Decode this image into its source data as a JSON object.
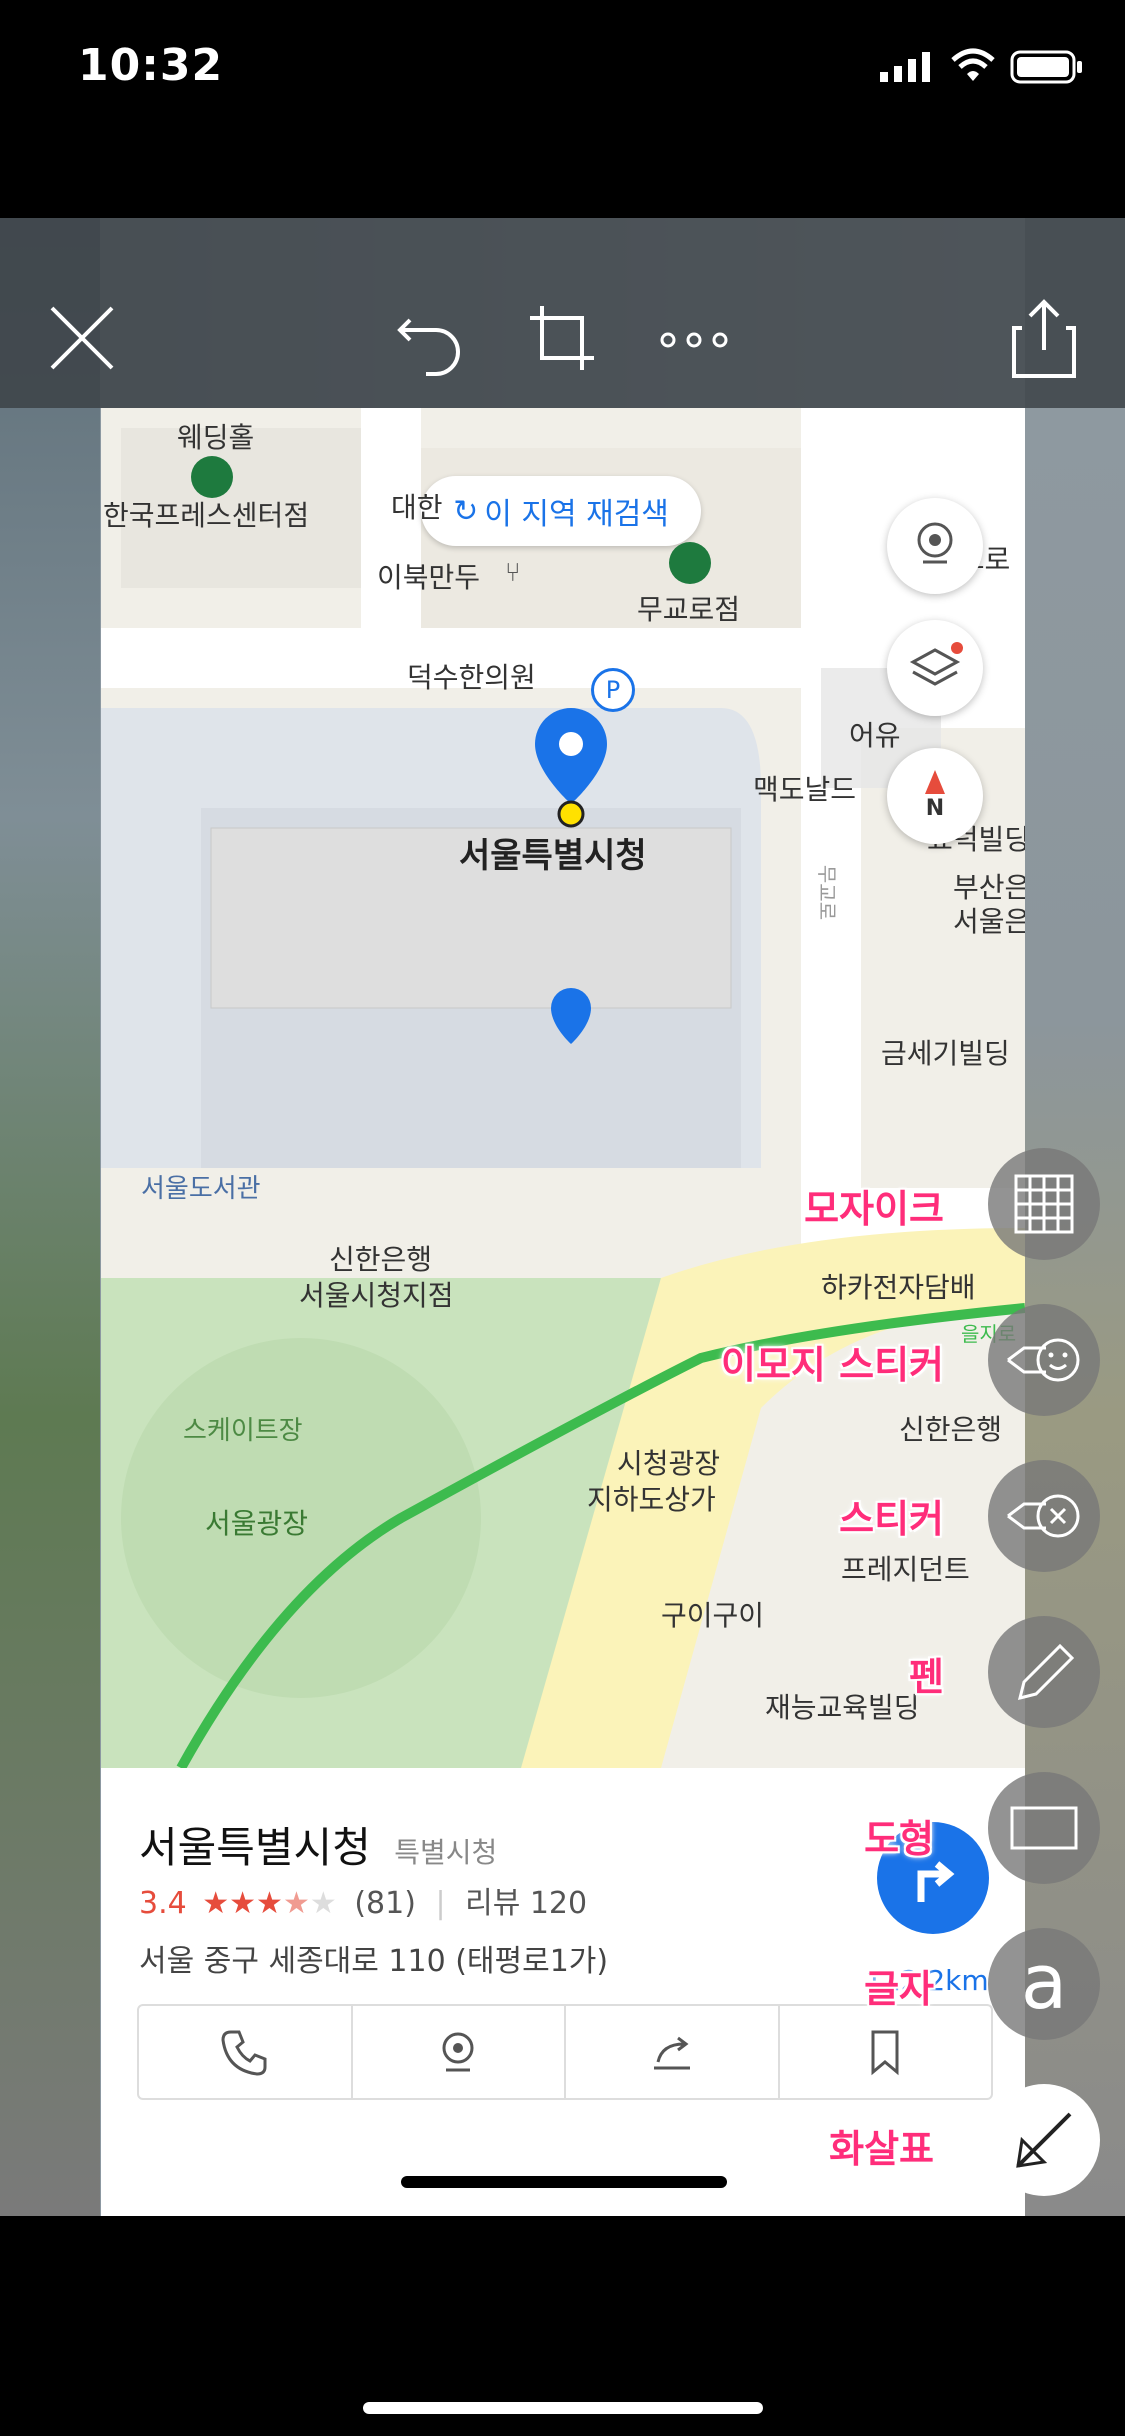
{
  "status_bar": {
    "time": "10:32"
  },
  "toolbar": {
    "close_icon": "close-icon",
    "undo_icon": "undo-icon",
    "crop_icon": "crop-icon",
    "more_icon": "more-icon",
    "share_icon": "share-icon"
  },
  "map": {
    "research_button": "이 지역 재검색",
    "labels": {
      "wedding": "웨딩홀",
      "press_center": "한국프레스센터점",
      "daehan": "대한",
      "ibuk": "이북만두",
      "mugyo": "무교로점",
      "metro": "메트로",
      "deoksu": "덕수한의원",
      "eoyu": "어유",
      "mcd": "맥도날드",
      "hyodeok": "효덕빌딩",
      "busan": "부산은",
      "seoul_u": "서울은",
      "seoul_city_hall": "서울특별시청",
      "mugyoro": "무교로",
      "geumse": "금세기빌딩",
      "library": "서울도서관",
      "shinhan1": "신한은행",
      "shinhan1b": "서울시청지점",
      "hakka": "하카전자담배",
      "euljiro": "을지로",
      "skate": "스케이트장",
      "plaza": "서울광장",
      "underground1": "시청광장",
      "underground2": "지하도상가",
      "shinhan2": "신한은행",
      "pres": "프레지던트",
      "guigui": "구이구이",
      "jaeneung": "재능교육빌딩"
    },
    "compass": "N"
  },
  "place_card": {
    "name": "서울특별시청",
    "category": "특별시청",
    "rating": "3.4",
    "rating_value": 3.4,
    "rating_count": "(81)",
    "reviews": "리뷰 120",
    "address": "서울 중구 세종대로 110 (태평로1가)",
    "distance": "112.2km",
    "actions": [
      "phone-icon",
      "location-icon",
      "share-icon",
      "bookmark-icon"
    ]
  },
  "markup_tools": [
    {
      "label": "모자이크",
      "icon": "mosaic-icon"
    },
    {
      "label": "이모지 스티커",
      "icon": "emoji-sticker-icon"
    },
    {
      "label": "스티커",
      "icon": "sticker-icon"
    },
    {
      "label": "펜",
      "icon": "pen-icon"
    },
    {
      "label": "도형",
      "icon": "shape-icon"
    },
    {
      "label": "글자",
      "icon": "text-icon"
    },
    {
      "label": "화살표",
      "icon": "arrow-icon"
    }
  ],
  "colors": {
    "accent": "#1a73e8",
    "label": "#ff2d7a",
    "rating": "#e64c3c",
    "route": "#3dbb4e"
  }
}
